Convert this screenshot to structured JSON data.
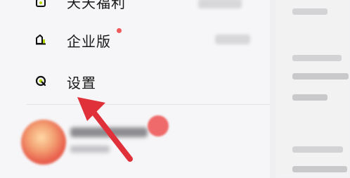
{
  "menu": {
    "items": [
      {
        "label": "天天福利",
        "icon": "gift-icon",
        "has_badge": false
      },
      {
        "label": "企业版",
        "icon": "enterprise-icon",
        "has_badge": true
      },
      {
        "label": "设置",
        "icon": "settings-icon",
        "has_badge": false
      }
    ]
  },
  "colors": {
    "icon_accent": "#b6d900",
    "badge_red": "#f05a5a",
    "arrow_red": "#e0303a"
  },
  "annotation": {
    "type": "arrow",
    "target": "设置"
  }
}
